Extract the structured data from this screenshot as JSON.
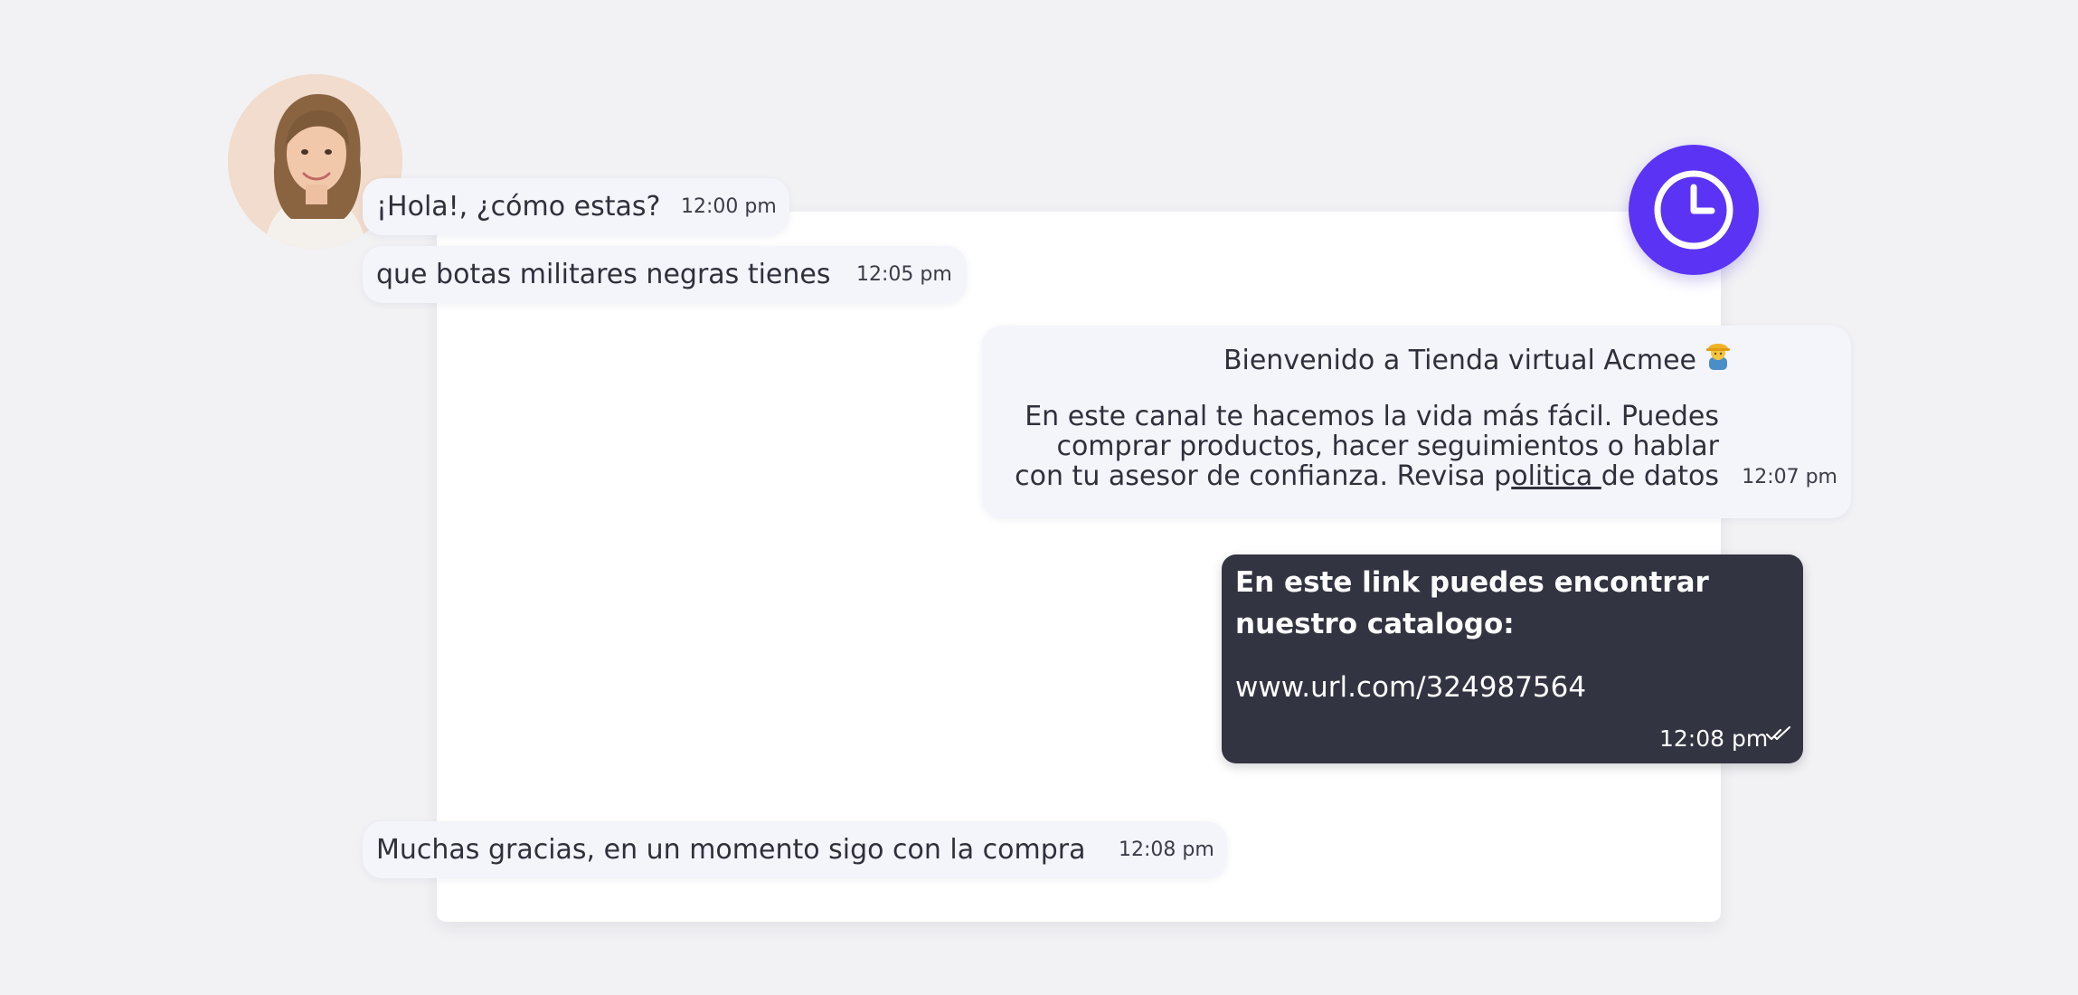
{
  "chat": {
    "messages": [
      {
        "sender": "customer",
        "text": "¡Hola!, ¿cómo estas?",
        "time": "12:00 pm"
      },
      {
        "sender": "customer",
        "text": "que botas militares negras tienes",
        "time": "12:05 pm"
      },
      {
        "sender": "business",
        "greeting": "Bienvenido a Tienda virtual Acmee",
        "greeting_emoji": "construction-worker-emoji",
        "body_lines": [
          "En este canal te hacemos la vida más fácil. Puedes",
          "comprar productos, hacer seguimientos o hablar"
        ],
        "body_last_prefix": "con tu asesor de confianza. Revisa p",
        "link_text": "olitica ",
        "body_last_suffix": "de datos",
        "time": "12:07 pm"
      },
      {
        "sender": "agent",
        "text": "En este link puedes encontrar nuestro catalogo:",
        "url": "www.url.com/324987564",
        "time": "12:08 pm",
        "status_icon": "double-check-icon"
      },
      {
        "sender": "customer",
        "text": "Muchas gracias, en un momento sigo con la compra",
        "time": "12:08 pm"
      }
    ]
  },
  "icons": {
    "avatar": "customer-avatar",
    "clock": "clock-icon"
  },
  "colors": {
    "background": "#f2f2f5",
    "panel": "#ffffff",
    "bubble_light": "#f4f4fb",
    "bubble_dark": "#323441",
    "accent": "#5b33f5",
    "text": "#2f303b"
  }
}
